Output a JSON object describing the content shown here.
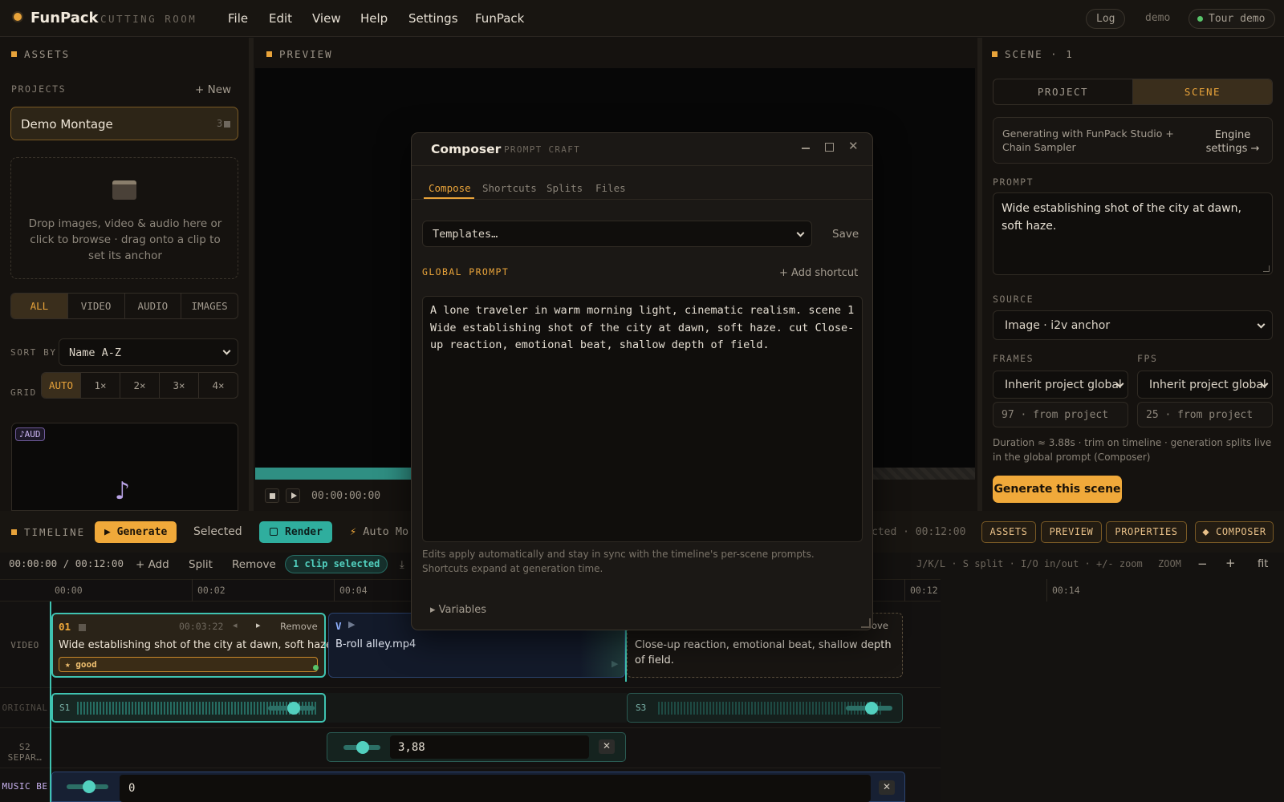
{
  "header": {
    "brand": "FunPack",
    "subtitle": "CUTTING ROOM",
    "menu": [
      "File",
      "Edit",
      "View",
      "Help",
      "Settings",
      "FunPack"
    ],
    "log": "Log",
    "user": "demo",
    "tour": "Tour demo"
  },
  "assets": {
    "title": "ASSETS",
    "projects_label": "PROJECTS",
    "new_label": "+ New",
    "project_name": "Demo Montage",
    "project_count": "3",
    "drop_text": "Drop images, video & audio here or click to browse · drag onto a clip to set its anchor",
    "filters": [
      "ALL",
      "VIDEO",
      "AUDIO",
      "IMAGES"
    ],
    "sort_label": "SORT BY",
    "sort_value": "Name A-Z",
    "grid_label": "GRID",
    "grid_options": [
      "AUTO",
      "1×",
      "2×",
      "3×",
      "4×"
    ],
    "thumb_badge": "♪AUD"
  },
  "preview": {
    "title": "PREVIEW",
    "timecode": "00:00:00:00"
  },
  "scene": {
    "title": "SCENE · 1",
    "tabs": [
      "PROJECT",
      "SCENE"
    ],
    "engine_text": "Generating with FunPack Studio + Chain Sampler",
    "engine_link": "Engine settings →",
    "prompt_label": "PROMPT",
    "prompt_value": "Wide establishing shot of the city at dawn, soft haze.",
    "source_label": "SOURCE",
    "source_value": "Image · i2v anchor",
    "frames_label": "FRAMES",
    "fps_label": "FPS",
    "frames_select": "Inherit project global",
    "fps_select": "Inherit project global",
    "frames_value": "97 · from project",
    "fps_value": "25 · from project",
    "duration_note": "Duration ≈ 3.88s · trim on timeline · generation splits live in the global prompt (Composer)",
    "generate_label": "Generate this scene"
  },
  "timeline": {
    "title": "TIMELINE",
    "generate": "▶ Generate",
    "selected": "Selected",
    "render": "Render",
    "auto_mode": "Auto Mo",
    "selected_time": "cted · 00:12:00",
    "chips": [
      "ASSETS",
      "PREVIEW",
      "PROPERTIES",
      "COMPOSER"
    ],
    "position": "00:00:00 / 00:12:00",
    "add": "+ Add",
    "split": "Split",
    "remove": "Remove",
    "clip_selected": "1 clip selected",
    "shortcuts": "J/K/L · S split · I/O in/out · +/- zoom",
    "zoom_label": "ZOOM",
    "zoom_minus": "−",
    "zoom_plus": "+",
    "fit": "fit",
    "ruler": [
      "00:00",
      "00:02",
      "00:04",
      "00:12",
      "00:14"
    ],
    "tracks": [
      "VIDEO",
      "ORIGINAL",
      "S2 SEPAR…",
      "MUSIC BE"
    ],
    "clip1": {
      "num": "01",
      "time": "00:03:22",
      "remove": "Remove",
      "text": "Wide establishing shot of the city at dawn, soft haze.",
      "badge": "★ good"
    },
    "clip2": {
      "tag": "V",
      "text": "B-roll alley.mp4"
    },
    "clip3": {
      "remove_partial": "ove",
      "text": "Close-up reaction, emotional beat, shallow depth of field."
    },
    "audio1_label": "S1",
    "audio3_label": "S3",
    "split_value": "3,88",
    "music_value": "0"
  },
  "composer": {
    "title": "Composer",
    "subtitle": "PROMPT CRAFT",
    "tabs": [
      "Compose",
      "Shortcuts",
      "Splits",
      "Files"
    ],
    "templates": "Templates…",
    "save": "Save",
    "global_label": "GLOBAL PROMPT",
    "add_shortcut": "+ Add shortcut",
    "global_text": "A lone traveler in warm morning light, cinematic realism. scene 1 Wide establishing shot of the city at dawn, soft haze. cut Close-up reaction, emotional beat, shallow depth of field.",
    "help": "Edits apply automatically and stay in sync with the timeline's per-scene prompts. Shortcuts expand at generation time.",
    "variables": "▸ Variables"
  }
}
